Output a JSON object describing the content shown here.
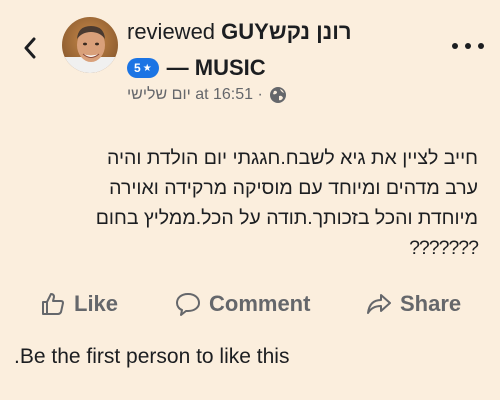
{
  "header": {
    "back_icon": "chevron-left-icon",
    "reviewed_word": "reviewed",
    "name_text": "GUYרונן נקש",
    "badge_text": "5",
    "badge_star": "★",
    "subtitle": "— MUSIC",
    "time_text": "יום שלישי at 16:51 ·",
    "privacy_icon": "globe-icon",
    "more_icon": "more-dots-icon",
    "accent_color": "#1b74e4"
  },
  "post": {
    "lines": [
      "חייב לציין את גיא לשבח.חגגתי יום הולדת  והיה",
      "ערב מדהים ומיוחד עם מוסיקה מרקידה ואוירה",
      "מיוחדת והכל בזכותך.תודה על הכל.ממליץ בחום"
    ],
    "unknown_glyphs": "???????"
  },
  "actions": {
    "like_label": "Like",
    "comment_label": "Comment",
    "share_label": "Share"
  },
  "footer": {
    "text": ".Be the first person to like this"
  }
}
